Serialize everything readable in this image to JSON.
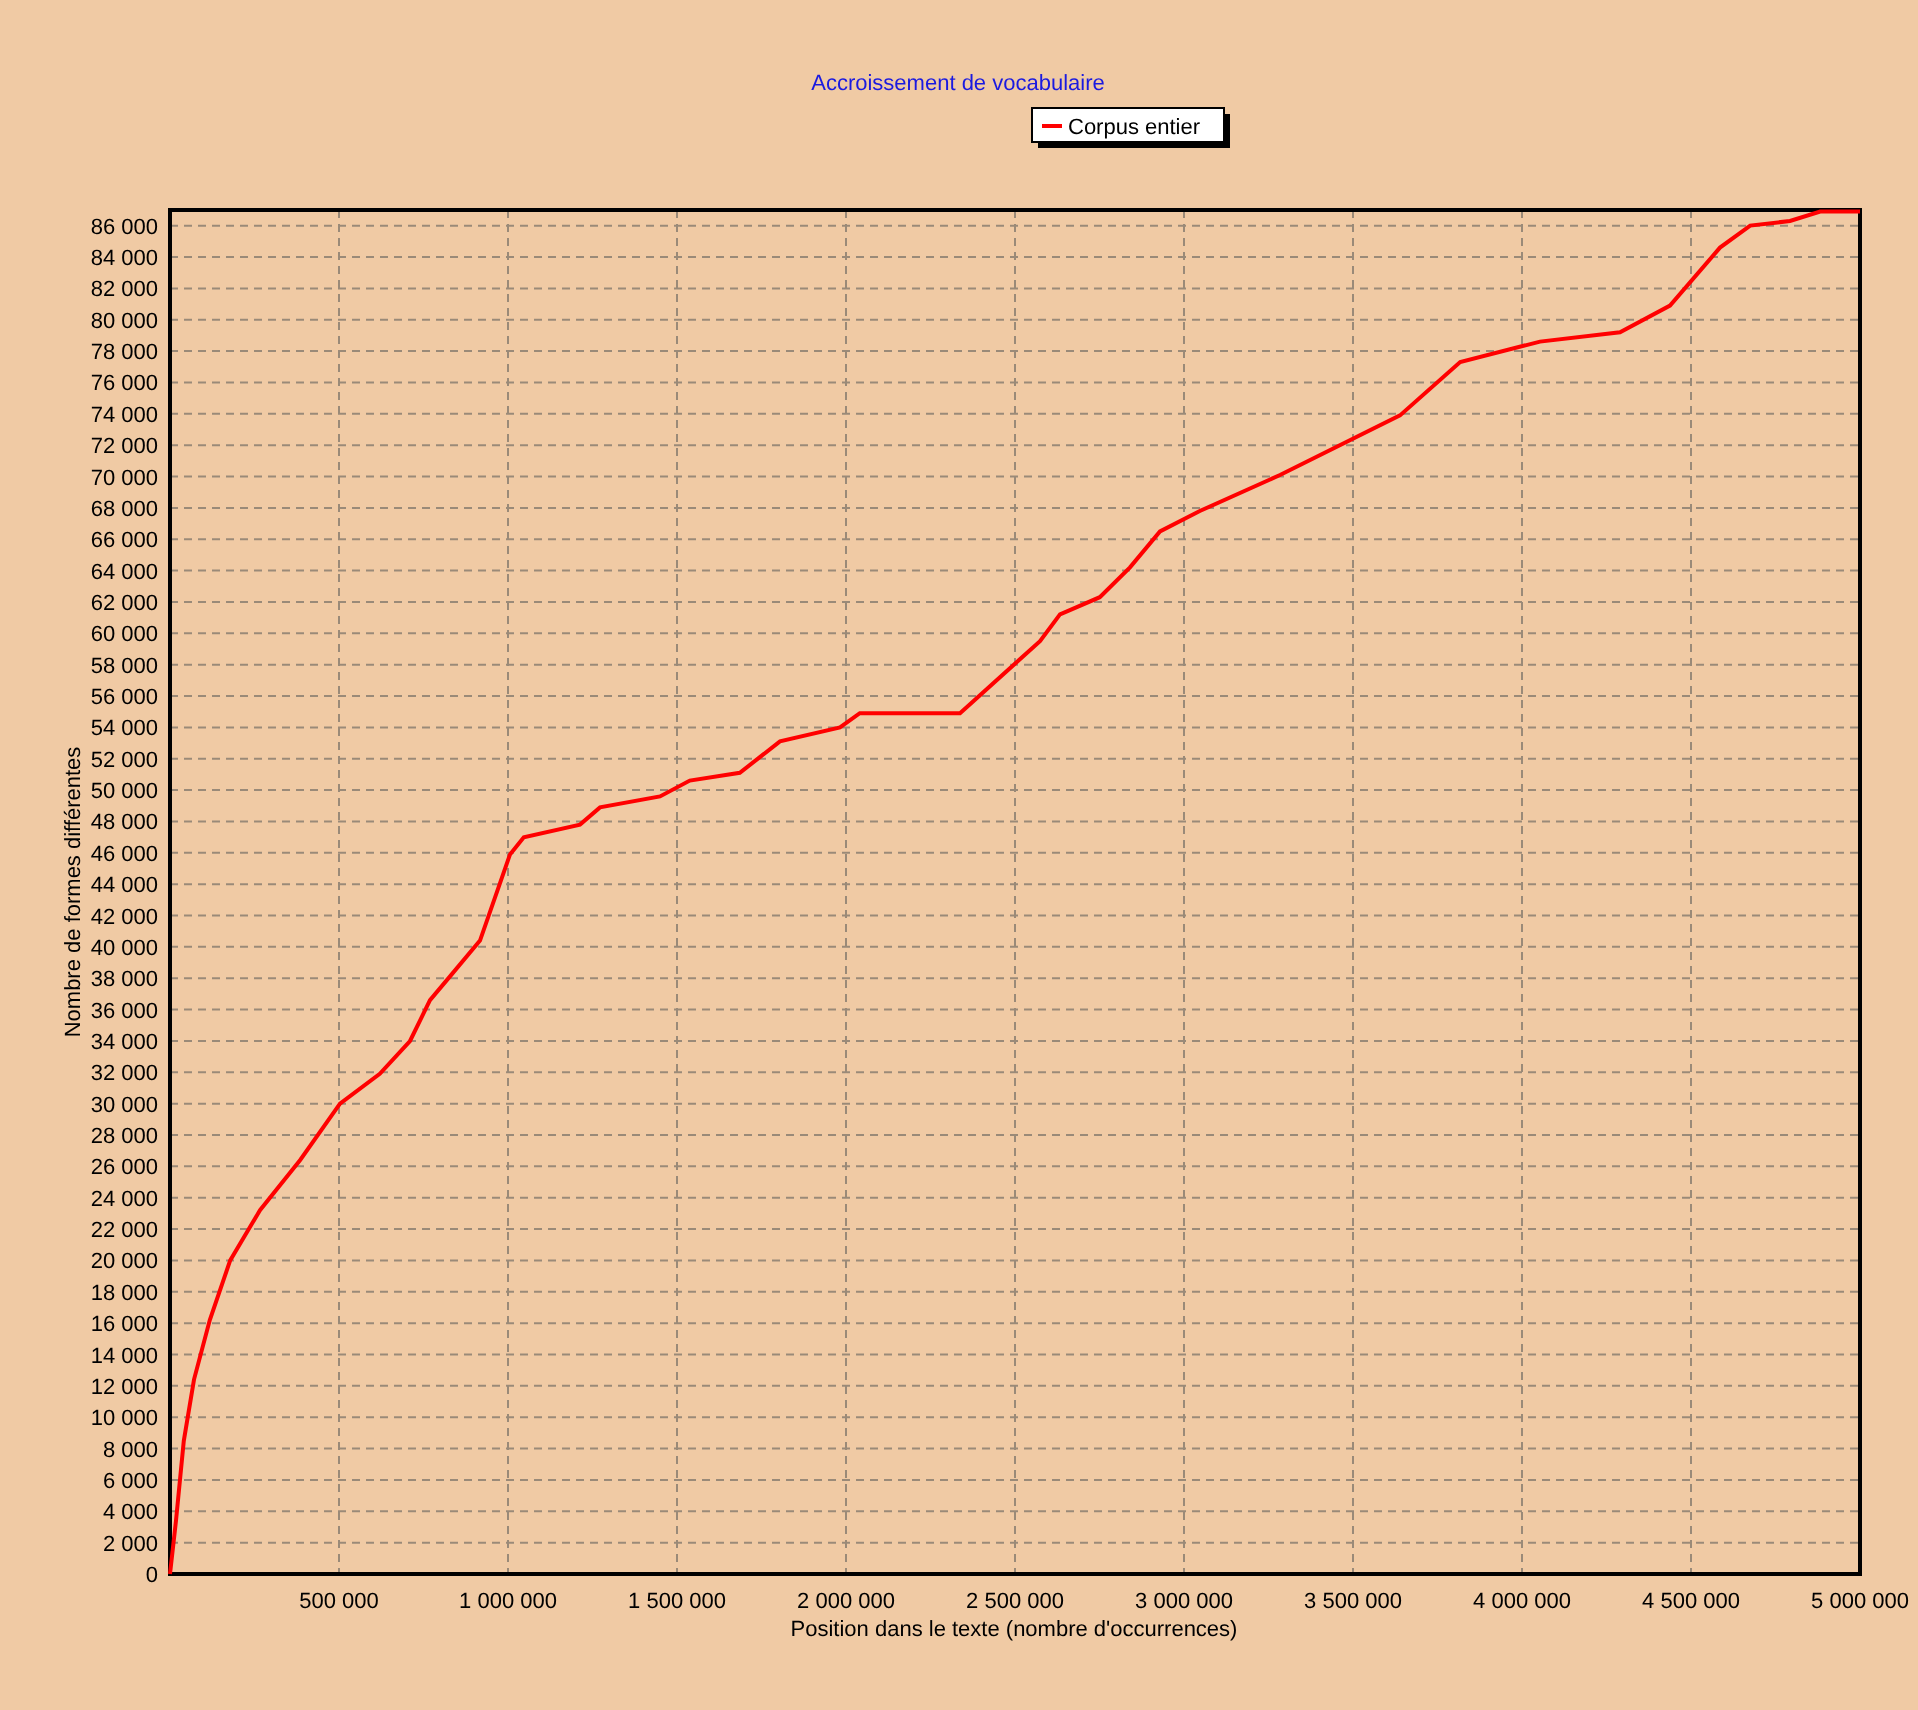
{
  "chart": {
    "chart_data": {
      "type": "line",
      "grid": true,
      "title": "Accroissement de vocabulaire",
      "xlabel": "Position dans le texte (nombre d'occurrences)",
      "ylabel": "Nombre de formes différentes",
      "xlim": [
        0,
        5000000
      ],
      "ylim": [
        0,
        87000
      ],
      "x": [
        0,
        18000,
        41000,
        71000,
        118000,
        178000,
        266000,
        385000,
        503000,
        621000,
        710000,
        769000,
        828000,
        917000,
        1006000,
        1047000,
        1213000,
        1272000,
        1450000,
        1538000,
        1686000,
        1805000,
        1982000,
        2041000,
        2337000,
        2574000,
        2633000,
        2751000,
        2840000,
        2929000,
        3047000,
        3284000,
        3639000,
        3817000,
        4053000,
        4290000,
        4438000,
        4586000,
        4675000,
        4793000,
        4882000,
        5000000
      ],
      "series": [
        {
          "name": "Corpus entier",
          "color": "#ff0000",
          "values": [
            0,
            3400,
            8500,
            12400,
            16200,
            20000,
            23200,
            26400,
            30000,
            31900,
            34000,
            36600,
            38100,
            40400,
            45900,
            47000,
            47800,
            48900,
            49600,
            50600,
            51100,
            53100,
            54000,
            54900,
            54900,
            59500,
            61200,
            62300,
            64200,
            66500,
            67800,
            70100,
            73900,
            77300,
            78600,
            79200,
            80900,
            84600,
            86000,
            86300,
            86900,
            86900
          ]
        }
      ],
      "xticks": [
        {
          "value": 500000,
          "label": "500 000"
        },
        {
          "value": 1000000,
          "label": "1 000 000"
        },
        {
          "value": 1500000,
          "label": "1 500 000"
        },
        {
          "value": 2000000,
          "label": "2 000 000"
        },
        {
          "value": 2500000,
          "label": "2 500 000"
        },
        {
          "value": 3000000,
          "label": "3 000 000"
        },
        {
          "value": 3500000,
          "label": "3 500 000"
        },
        {
          "value": 4000000,
          "label": "4 000 000"
        },
        {
          "value": 4500000,
          "label": "4 500 000"
        },
        {
          "value": 5000000,
          "label": "5 000 000"
        }
      ],
      "yticks": [
        {
          "value": 0,
          "label": "0"
        },
        {
          "value": 2000,
          "label": "2 000"
        },
        {
          "value": 4000,
          "label": "4 000"
        },
        {
          "value": 6000,
          "label": "6 000"
        },
        {
          "value": 8000,
          "label": "8 000"
        },
        {
          "value": 10000,
          "label": "10 000"
        },
        {
          "value": 12000,
          "label": "12 000"
        },
        {
          "value": 14000,
          "label": "14 000"
        },
        {
          "value": 16000,
          "label": "16 000"
        },
        {
          "value": 18000,
          "label": "18 000"
        },
        {
          "value": 20000,
          "label": "20 000"
        },
        {
          "value": 22000,
          "label": "22 000"
        },
        {
          "value": 24000,
          "label": "24 000"
        },
        {
          "value": 26000,
          "label": "26 000"
        },
        {
          "value": 28000,
          "label": "28 000"
        },
        {
          "value": 30000,
          "label": "30 000"
        },
        {
          "value": 32000,
          "label": "32 000"
        },
        {
          "value": 34000,
          "label": "34 000"
        },
        {
          "value": 36000,
          "label": "36 000"
        },
        {
          "value": 38000,
          "label": "38 000"
        },
        {
          "value": 40000,
          "label": "40 000"
        },
        {
          "value": 42000,
          "label": "42 000"
        },
        {
          "value": 44000,
          "label": "44 000"
        },
        {
          "value": 46000,
          "label": "46 000"
        },
        {
          "value": 48000,
          "label": "48 000"
        },
        {
          "value": 50000,
          "label": "50 000"
        },
        {
          "value": 52000,
          "label": "52 000"
        },
        {
          "value": 54000,
          "label": "54 000"
        },
        {
          "value": 56000,
          "label": "56 000"
        },
        {
          "value": 58000,
          "label": "58 000"
        },
        {
          "value": 60000,
          "label": "60 000"
        },
        {
          "value": 62000,
          "label": "62 000"
        },
        {
          "value": 64000,
          "label": "64 000"
        },
        {
          "value": 66000,
          "label": "66 000"
        },
        {
          "value": 68000,
          "label": "68 000"
        },
        {
          "value": 70000,
          "label": "70 000"
        },
        {
          "value": 72000,
          "label": "72 000"
        },
        {
          "value": 74000,
          "label": "74 000"
        },
        {
          "value": 76000,
          "label": "76 000"
        },
        {
          "value": 78000,
          "label": "78 000"
        },
        {
          "value": 80000,
          "label": "80 000"
        },
        {
          "value": 82000,
          "label": "82 000"
        },
        {
          "value": 84000,
          "label": "84 000"
        },
        {
          "value": 86000,
          "label": "86 000"
        }
      ]
    }
  }
}
